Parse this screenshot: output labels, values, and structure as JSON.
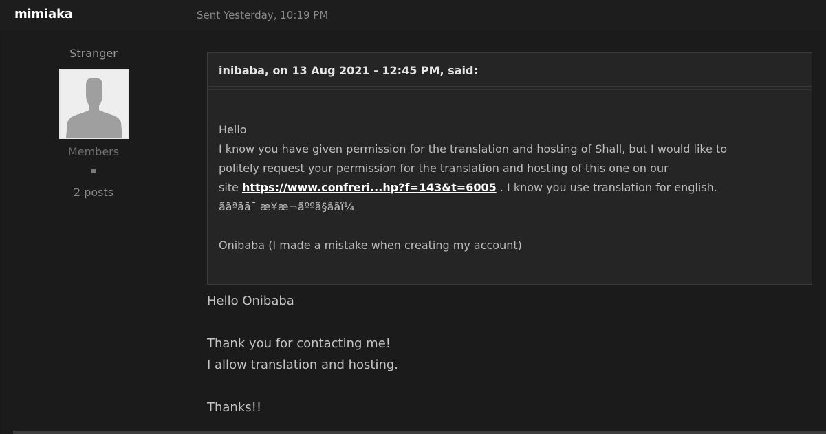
{
  "post": {
    "author_name": "mimiaka",
    "sent": "Sent Yesterday, 10:19 PM",
    "author_title": "Stranger",
    "group": "Members",
    "post_count": "2 posts",
    "avatar_icon": "default-user-silhouette"
  },
  "quote": {
    "citation": "inibaba, on 13 Aug 2021 - 12:45 PM, said:",
    "line1": "Hello",
    "line2": "I know you have given permission for the translation and hosting of Shall, but I would like to",
    "line3": "politely request your permission for the translation and hosting of this one on our",
    "line4_prefix": "site ",
    "link": "https://www.confreri...hp?f=143&t=6005",
    "line4_suffix": " . I know you use translation for english.",
    "line5": "ããªãã¯ æ¥æ¬äººã§ããï¼",
    "line6": "Onibaba (I made a mistake when creating my account)"
  },
  "reply": {
    "line1": "Hello Onibaba",
    "line2": "Thank you for contacting me!",
    "line3": "I allow translation and hosting.",
    "line4": "Thanks!!"
  },
  "colors": {
    "background": "#1b1b1b",
    "quote_bg": "#252525",
    "link": "#ffffff"
  }
}
